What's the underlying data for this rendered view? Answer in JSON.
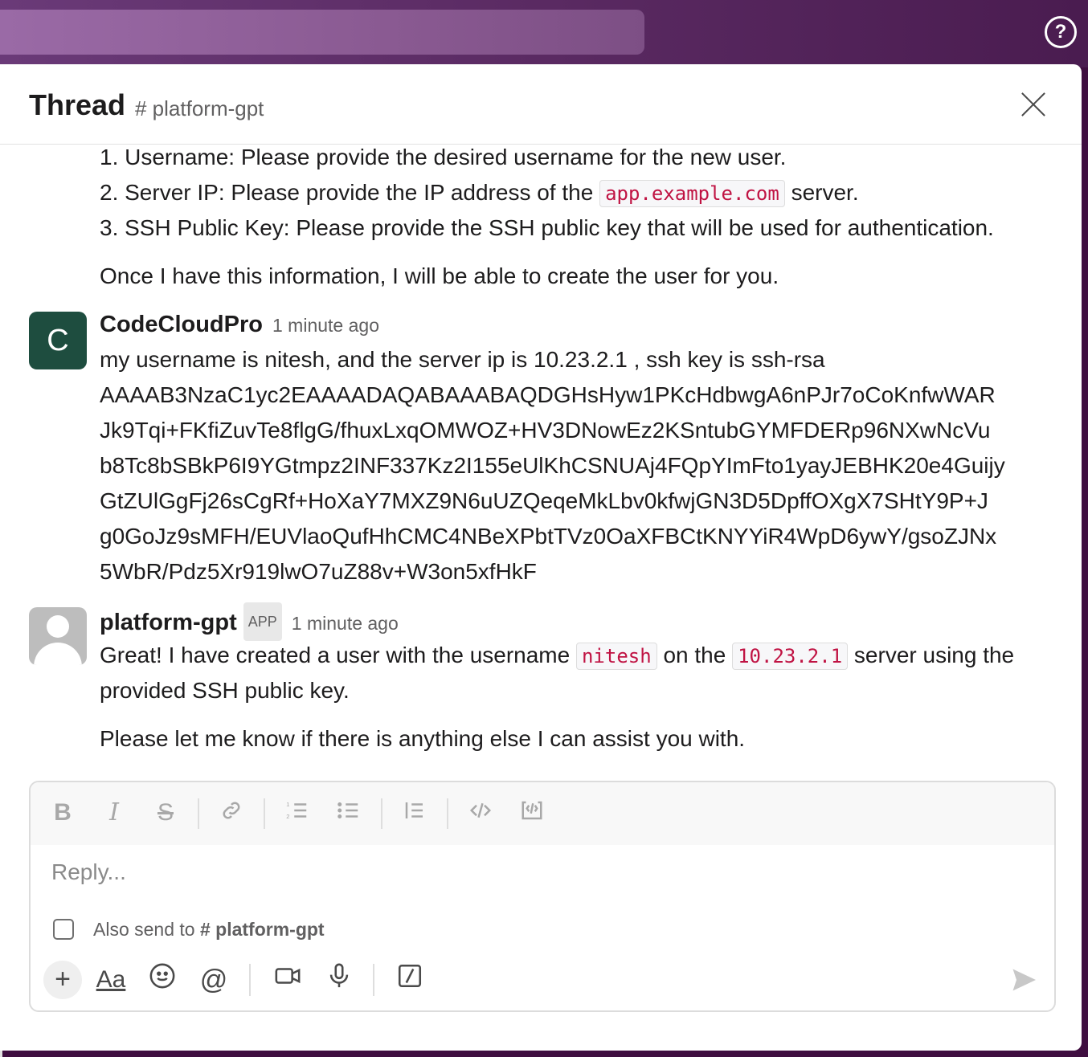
{
  "help_icon": "question-circle-icon",
  "header": {
    "title": "Thread",
    "channel": "# platform-gpt"
  },
  "messages": {
    "prev": {
      "item1": "1. Username: Please provide the desired username for the new user.",
      "item2_pre": "2. Server IP: Please provide the IP address of the ",
      "item2_code": "app.example.com",
      "item2_post": " server.",
      "item3": "3. SSH Public Key: Please provide the SSH public key that will be used for authentication.",
      "closing": "Once I have this information, I will be able to create the user for you."
    },
    "user": {
      "avatar_letter": "C",
      "name": "CodeCloudPro",
      "time": "1 minute ago",
      "lines": [
        "my username is nitesh, and the server ip is 10.23.2.1 , ssh key is ssh-rsa",
        "AAAAB3NzaC1yc2EAAAADAQABAAABAQDGHsHyw1PKcHdbwgA6nPJr7oCoKnfwWAR",
        "Jk9Tqi+FKfiZuvTe8flgG/fhuxLxqOMWOZ+HV3DNowEz2KSntubGYMFDERp96NXwNcVu",
        "b8Tc8bSBkP6I9YGtmpz2INF337Kz2I155eUlKhCSNUAj4FQpYImFto1yayJEBHK20e4Guijy",
        "GtZUlGgFj26sCgRf+HoXaY7MXZ9N6uUZQeqeMkLbv0kfwjGN3D5DpffOXgX7SHtY9P+J",
        "g0GoJz9sMFH/EUVlaoQufHhCMC4NBeXPbtTVz0OaXFBCtKNYYiR4WpD6ywY/gsoZJNx",
        "5WbR/Pdz5Xr919lwO7uZ88v+W3on5xfHkF"
      ]
    },
    "bot": {
      "name": "platform-gpt",
      "badge": "APP",
      "time": "1 minute ago",
      "line1_pre": "Great! I have created a user with the username ",
      "line1_code1": "nitesh",
      "line1_mid": " on the ",
      "line1_code2": "10.23.2.1",
      "line1_post": " server using the",
      "line2": "provided SSH public key.",
      "closing": "Please let me know if there is anything else I can assist you with."
    }
  },
  "composer": {
    "placeholder": "Reply...",
    "also_send_label": "Also send to",
    "also_send_channel": "# platform-gpt",
    "format_icons": [
      "bold-icon",
      "italic-icon",
      "strikethrough-icon",
      "link-icon",
      "ordered-list-icon",
      "bulleted-list-icon",
      "blockquote-icon",
      "code-icon",
      "code-block-icon"
    ],
    "bottom_icons": [
      "plus-icon",
      "formatting-icon",
      "emoji-icon",
      "mention-icon",
      "video-icon",
      "microphone-icon",
      "slash-command-icon",
      "send-icon"
    ],
    "formatting_label": "Aa"
  }
}
